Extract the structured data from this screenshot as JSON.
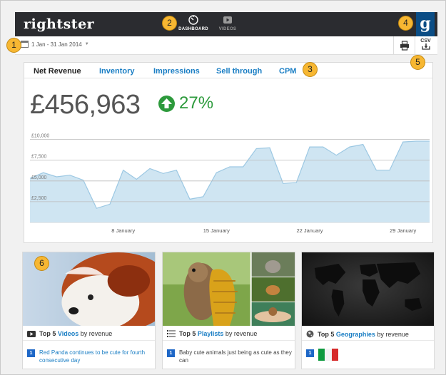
{
  "app": {
    "logo_text": "rightster"
  },
  "nav": [
    {
      "label": "DASHBOARD",
      "icon": "dashboard-icon",
      "active": true
    },
    {
      "label": "VIDEOS",
      "icon": "video-icon",
      "active": false
    }
  ],
  "toolbar": {
    "date_range": "1 Jan - 31 Jan 2014",
    "csv_label": "CSV"
  },
  "partner_badge": "g",
  "markers": [
    "1",
    "2",
    "3",
    "4",
    "5",
    "6"
  ],
  "tabs": [
    "Net Revenue",
    "Inventory",
    "Impressions",
    "Sell through",
    "CPM"
  ],
  "summary": {
    "value": "£456,963",
    "change": "27%"
  },
  "colors": {
    "accent": "#1a7ec4",
    "positive": "#2d9a3c",
    "area": "#cfe5f2",
    "header": "#2b2c30"
  },
  "chart_data": {
    "type": "area",
    "ylabels": [
      "£10,000",
      "£7,500",
      "£5,000",
      "£2,500"
    ],
    "yticks": [
      10000,
      7500,
      5000,
      2500
    ],
    "ylim": [
      0,
      11000
    ],
    "xlabels": [
      "8 January",
      "15 January",
      "22 January",
      "29 January"
    ],
    "xlabel_days": [
      8,
      15,
      22,
      29
    ],
    "x": [
      1,
      2,
      3,
      4,
      5,
      6,
      7,
      8,
      9,
      10,
      11,
      12,
      13,
      14,
      15,
      16,
      17,
      18,
      19,
      20,
      21,
      22,
      23,
      24,
      25,
      26,
      27,
      28,
      29,
      30,
      31
    ],
    "values": [
      5300,
      6000,
      5500,
      5700,
      5100,
      1700,
      2200,
      6300,
      5200,
      6500,
      5900,
      6300,
      2800,
      3100,
      6000,
      6700,
      6700,
      8900,
      9000,
      4700,
      4800,
      9100,
      9100,
      8100,
      9100,
      9400,
      6300,
      6300,
      9700,
      9800,
      9800
    ]
  },
  "cards": [
    {
      "title_pre": "Top 5",
      "title_hl": "Videos",
      "title_post": "by revenue",
      "rank": "1",
      "item": "Red Panda continues to be cute for fourth consecutive day"
    },
    {
      "title_pre": "Top 5",
      "title_hl": "Playlists",
      "title_post": "by revenue",
      "rank": "1",
      "item": "Baby cute animals just being as cute as they can"
    },
    {
      "title_pre": "Top 5",
      "title_hl": "Geographies",
      "title_post": "by revenue",
      "rank": "1",
      "item_flag": "italy-flag"
    }
  ]
}
